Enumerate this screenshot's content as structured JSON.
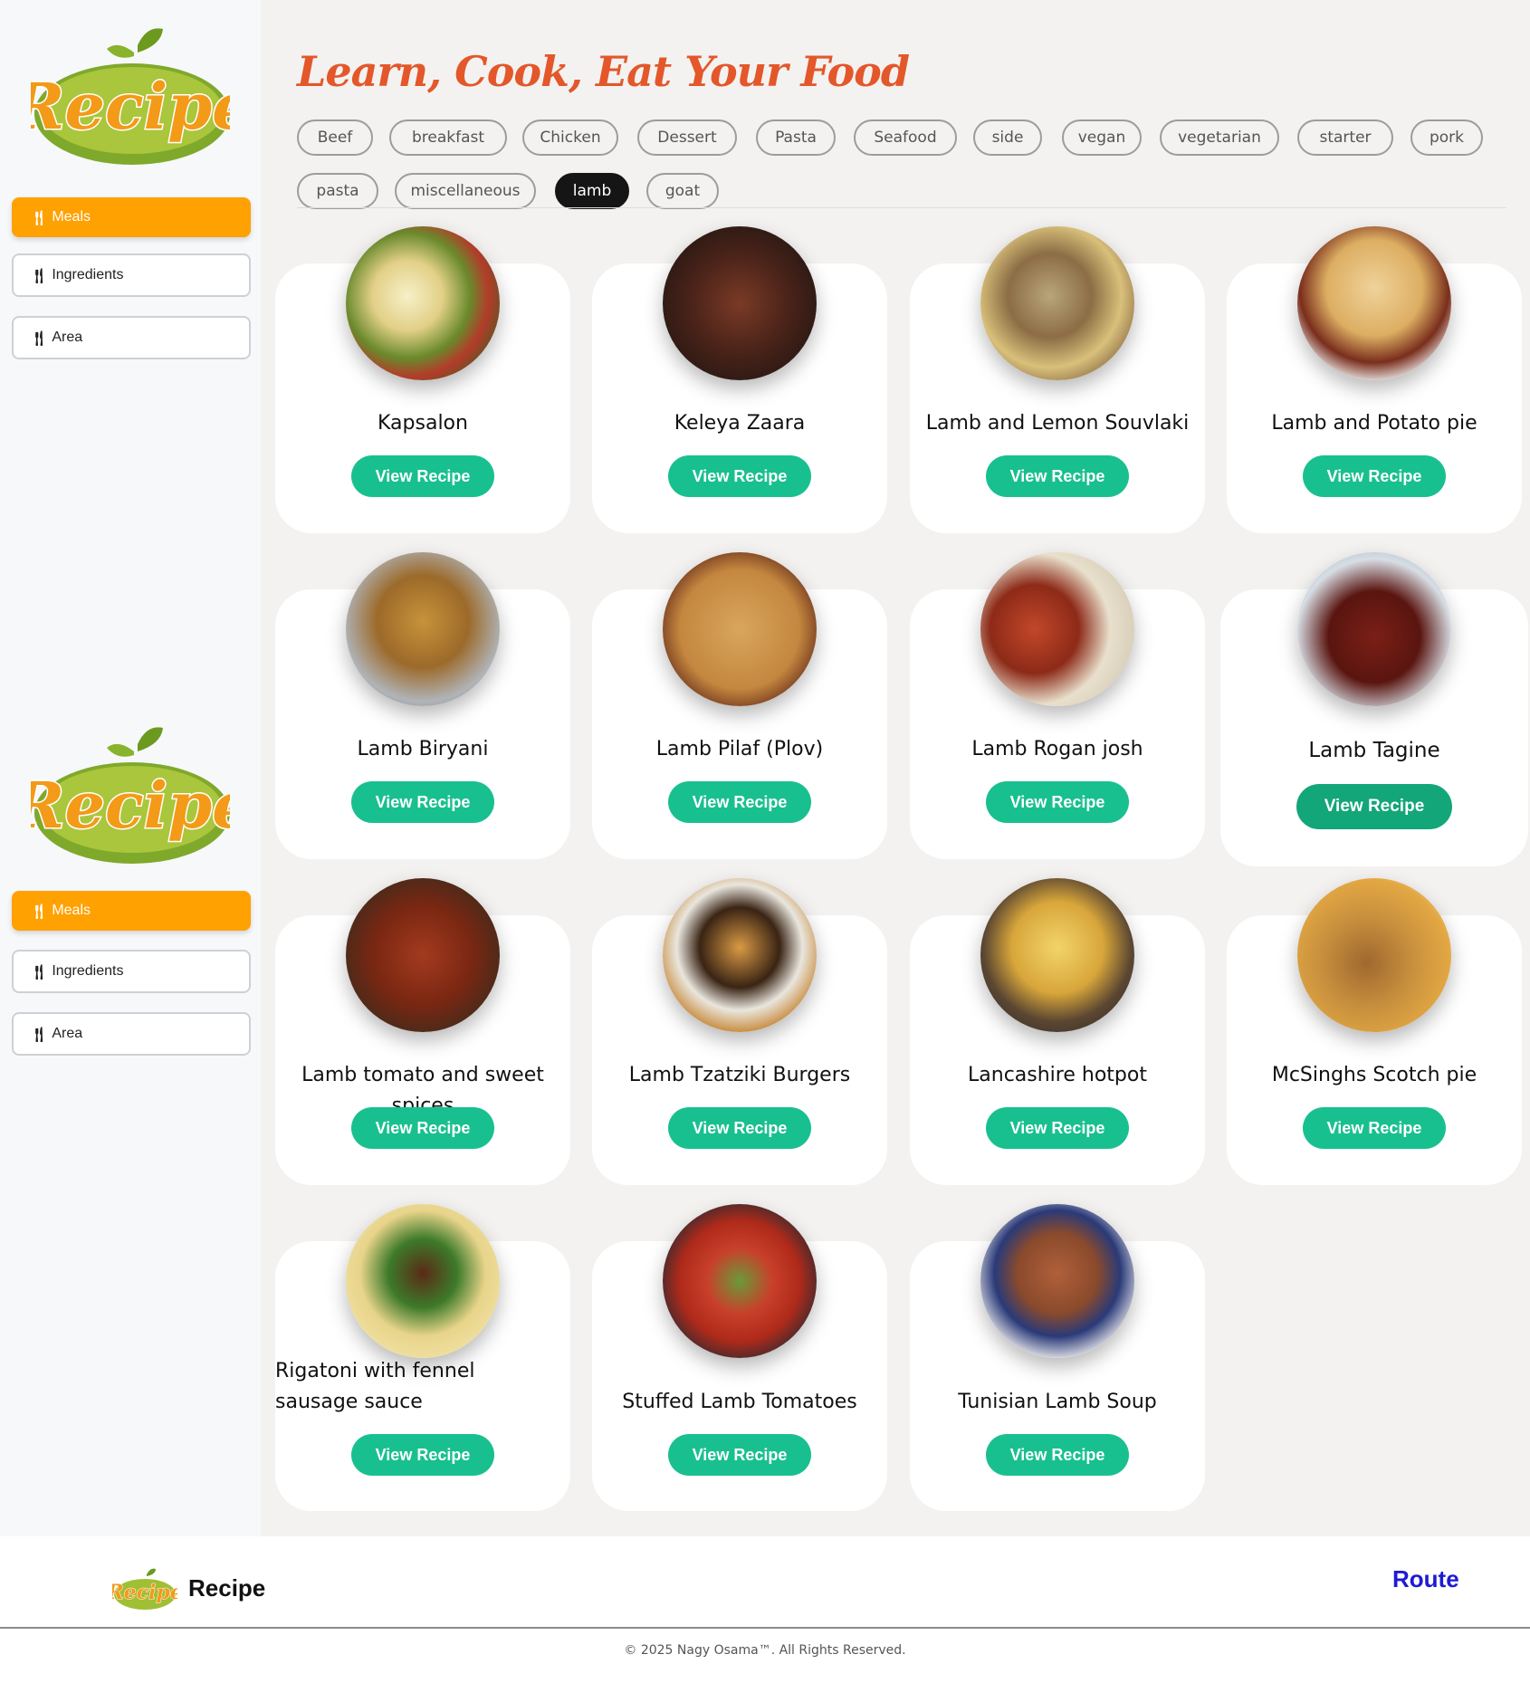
{
  "brand": {
    "logo_text": "Recipe"
  },
  "sidebar": {
    "items": [
      {
        "icon": "fork-knife-icon",
        "label": "Meals",
        "active": true
      },
      {
        "icon": "fork-knife-icon",
        "label": "Ingredients",
        "active": false
      },
      {
        "icon": "fork-knife-icon",
        "label": "Area",
        "active": false
      }
    ]
  },
  "header": {
    "title": "Learn, Cook, Eat Your Food"
  },
  "categories": [
    {
      "label": "Beef"
    },
    {
      "label": "breakfast"
    },
    {
      "label": "Chicken"
    },
    {
      "label": "Dessert"
    },
    {
      "label": "Pasta"
    },
    {
      "label": "Seafood"
    },
    {
      "label": "side"
    },
    {
      "label": "vegan"
    },
    {
      "label": "vegetarian"
    },
    {
      "label": "starter"
    },
    {
      "label": "pork"
    },
    {
      "label": "pasta"
    },
    {
      "label": "miscellaneous"
    },
    {
      "label": "lamb",
      "active": true
    },
    {
      "label": "goat"
    }
  ],
  "meals": [
    {
      "name": "Kapsalon",
      "button": "View Recipe"
    },
    {
      "name": "Keleya Zaara",
      "button": "View Recipe"
    },
    {
      "name": "Lamb and Lemon Souvlaki",
      "button": "View Recipe"
    },
    {
      "name": "Lamb and Potato pie",
      "button": "View Recipe"
    },
    {
      "name": "Lamb Biryani",
      "button": "View Recipe"
    },
    {
      "name": "Lamb Pilaf (Plov)",
      "button": "View Recipe"
    },
    {
      "name": "Lamb Rogan josh",
      "button": "View Recipe"
    },
    {
      "name": "Lamb Tagine",
      "button": "View Recipe",
      "hovered": true
    },
    {
      "name": "Lamb tomato and sweet spices",
      "button": "View Recipe"
    },
    {
      "name": "Lamb Tzatziki Burgers",
      "button": "View Recipe"
    },
    {
      "name": "Lancashire hotpot",
      "button": "View Recipe"
    },
    {
      "name": "McSinghs Scotch pie",
      "button": "View Recipe"
    },
    {
      "name": "Rigatoni with fennel sausage sauce",
      "button": "View Recipe"
    },
    {
      "name": "Stuffed Lamb Tomatoes",
      "button": "View Recipe"
    },
    {
      "name": "Tunisian Lamb Soup",
      "button": "View Recipe"
    }
  ],
  "footer": {
    "brand": "Recipe",
    "route_link": "Route",
    "copyright": "© 2025 Nagy Osama™. All Rights Reserved."
  },
  "colors": {
    "accent_orange": "#ffa100",
    "title": "#e3572a",
    "button_green": "#19c08f",
    "route_link": "#1d1ad6"
  }
}
